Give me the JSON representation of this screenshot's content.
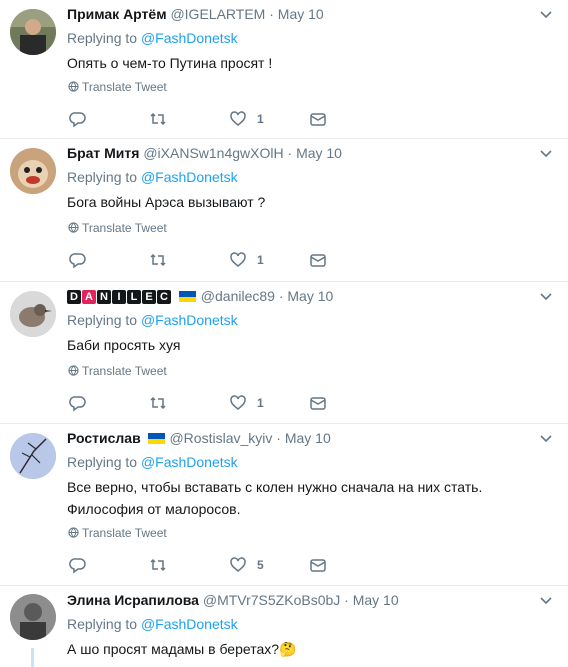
{
  "tweets": [
    {
      "name": "Примак Артём",
      "handle": "@IGELARTEM",
      "dot": "·",
      "date": "May 10",
      "reply_prefix": "Replying to ",
      "reply_to": "@FashDonetsk",
      "text": "Опять о чем-то Путина просят !",
      "translate": "Translate Tweet",
      "likes": "1",
      "flag": false
    },
    {
      "name": "Брат Митя",
      "handle": "@iXANSw1n4gwXOlH",
      "dot": "·",
      "date": "May 10",
      "reply_prefix": "Replying to ",
      "reply_to": "@FashDonetsk",
      "text": "Бога войны Арэса вызывают ?",
      "translate": "Translate Tweet",
      "likes": "1",
      "flag": false
    },
    {
      "name_letters": [
        "D",
        "A",
        "N",
        "I",
        "L",
        "E",
        "C"
      ],
      "handle": "@danilec89",
      "dot": "·",
      "date": "May 10",
      "reply_prefix": "Replying to ",
      "reply_to": "@FashDonetsk",
      "text": "Баби просять хуя",
      "translate": "Translate Tweet",
      "likes": "1",
      "flag": true
    },
    {
      "name": "Ростислав",
      "handle": "@Rostislav_kyiv",
      "dot": "·",
      "date": "May 10",
      "reply_prefix": "Replying to ",
      "reply_to": "@FashDonetsk",
      "text_line1": "Все верно, чтобы вставать с колен нужно сначала на них стать.",
      "text_line2": "Философия от малоросов.",
      "translate": "Translate Tweet",
      "likes": "5",
      "flag": true
    },
    {
      "name": "Элина Исрапилова",
      "handle": "@MTVr7S5ZKoBs0bJ",
      "dot": "·",
      "date": "May 10",
      "reply_prefix": "Replying to ",
      "reply_to": "@FashDonetsk",
      "text": "А шо просят мадамы в беретах?",
      "emoji": "🤔",
      "flag": false
    }
  ],
  "colors": {
    "link": "#1da1f2",
    "muted": "#657786",
    "text": "#14171a",
    "divider": "#e6ecf0",
    "thread_line": "#c7e3f7"
  },
  "icons": [
    "globe-icon",
    "reply-icon",
    "retweet-icon",
    "like-icon",
    "dm-icon",
    "caret-down-icon",
    "ukraine-flag-icon"
  ]
}
